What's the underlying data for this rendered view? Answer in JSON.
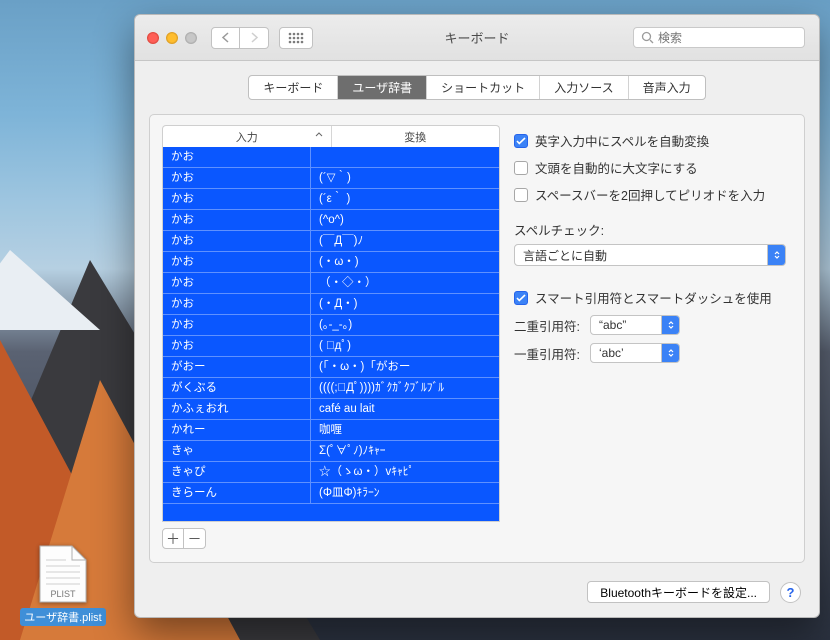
{
  "window": {
    "title": "キーボード",
    "search_placeholder": "検索",
    "bluetooth_button": "Bluetoothキーボードを設定...",
    "add_label": "＋",
    "remove_label": "－",
    "help": "?"
  },
  "tabs": [
    {
      "label": "キーボード"
    },
    {
      "label": "ユーザ辞書",
      "active": true
    },
    {
      "label": "ショートカット"
    },
    {
      "label": "入力ソース"
    },
    {
      "label": "音声入力"
    }
  ],
  "columns": {
    "input": "入力",
    "output": "変換"
  },
  "table": [
    {
      "in": "かお",
      "out": ""
    },
    {
      "in": "かお",
      "out": "(´▽｀)"
    },
    {
      "in": "かお",
      "out": "(´ε｀ )"
    },
    {
      "in": "かお",
      "out": "(^o^)"
    },
    {
      "in": "かお",
      "out": "(￣Д￣)ﾉ"
    },
    {
      "in": "かお",
      "out": "(・ω・)"
    },
    {
      "in": "かお",
      "out": "（・◇・）"
    },
    {
      "in": "かお",
      "out": "(・Д・)"
    },
    {
      "in": "かお",
      "out": "(｡-_-｡)"
    },
    {
      "in": "かお",
      "out": "( ﾟдﾟ)"
    },
    {
      "in": "がおー",
      "out": "(「・ω・)「がおー"
    },
    {
      "in": "がくぶる",
      "out": "((((;ﾟДﾟ))))ｶﾞｸｶﾞｸﾌﾞﾙﾌﾞﾙ"
    },
    {
      "in": "かふぇおれ",
      "out": "café au lait"
    },
    {
      "in": "かれー",
      "out": "咖喱"
    },
    {
      "in": "きゃ",
      "out": "Σ(ﾟ∀ﾟﾉ)ﾉｷｬｰ"
    },
    {
      "in": "きゃぴ",
      "out": "☆（ゝω・）vｷｬﾋﾟ"
    },
    {
      "in": "きらーん",
      "out": "(Φ皿Φ)ｷﾗｰﾝ"
    }
  ],
  "options": {
    "autocorrect": {
      "label": "英字入力中にスペルを自動変換",
      "checked": true
    },
    "capitalize": {
      "label": "文頭を自動的に大文字にする",
      "checked": false
    },
    "doublespace": {
      "label": "スペースバーを2回押してピリオドを入力",
      "checked": false
    },
    "spellcheck_label": "スペルチェック:",
    "spellcheck_value": "言語ごとに自動",
    "smartquotes": {
      "label": "スマート引用符とスマートダッシュを使用",
      "checked": true
    },
    "doublequote_label": "二重引用符:",
    "doublequote_value": "“abc”",
    "singlequote_label": "一重引用符:",
    "singlequote_value": "‘abc’"
  },
  "desktop_file": {
    "badge": "PLIST",
    "name": "ユーザ辞書.plist"
  }
}
